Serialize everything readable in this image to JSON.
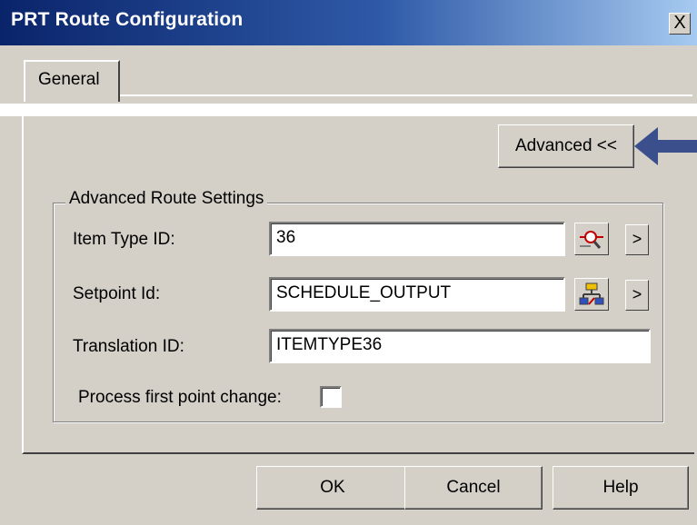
{
  "window": {
    "title": "PRT Route Configuration",
    "close_label": "X"
  },
  "tabs": [
    {
      "label": "General",
      "selected": true
    }
  ],
  "advanced_button": {
    "label": "Advanced <<"
  },
  "group": {
    "title": "Advanced Route Settings",
    "fields": {
      "item_type": {
        "label": "Item Type ID:",
        "value": "36",
        "icon": "lookup-magnifier-icon",
        "more_label": ">"
      },
      "setpoint": {
        "label": "Setpoint Id:",
        "value": "SCHEDULE_OUTPUT",
        "icon": "setpoint-network-icon",
        "more_label": ">"
      },
      "translation": {
        "label": "Translation ID:",
        "value": "ITEMTYPE36"
      }
    },
    "checkbox": {
      "label": "Process first point change:",
      "checked": false
    }
  },
  "buttons": {
    "ok": "OK",
    "cancel": "Cancel",
    "help": "Help"
  },
  "colors": {
    "title_start": "#0a246a",
    "title_end": "#a6caf0",
    "dialog_bg": "#d4d0c8",
    "arrow": "#3b4f8c"
  }
}
